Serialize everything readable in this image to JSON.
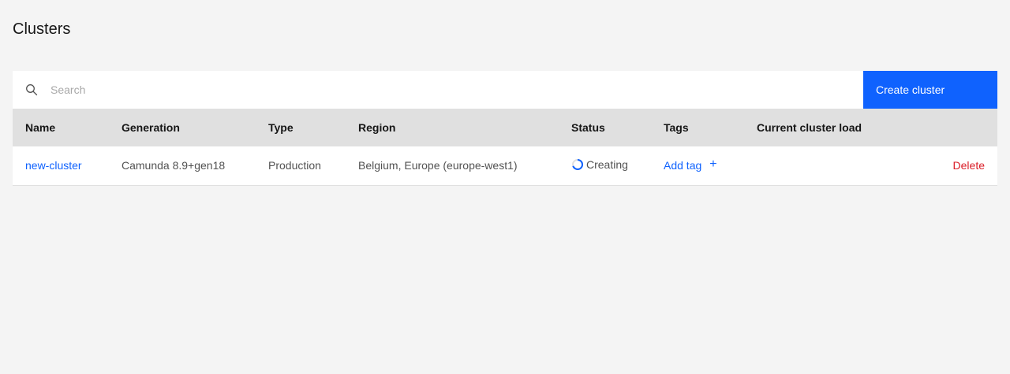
{
  "page": {
    "title": "Clusters"
  },
  "toolbar": {
    "search_placeholder": "Search",
    "search_value": "",
    "create_label": "Create cluster"
  },
  "table": {
    "columns": [
      "Name",
      "Generation",
      "Type",
      "Region",
      "Status",
      "Tags",
      "Current cluster load"
    ],
    "rows": [
      {
        "name": "new-cluster",
        "generation": "Camunda 8.9+gen18",
        "type": "Production",
        "region": "Belgium, Europe (europe-west1)",
        "status": "Creating",
        "tag_action": "Add tag",
        "tag_action_icon": "+",
        "load": "",
        "delete_label": "Delete"
      }
    ]
  },
  "colors": {
    "accent": "#0f62fe",
    "danger": "#da1e28",
    "header_bg": "#e0e0e0",
    "page_bg": "#f4f4f4"
  },
  "icons": {
    "search": "search-icon",
    "status": "spinner-icon",
    "add": "plus-icon"
  }
}
